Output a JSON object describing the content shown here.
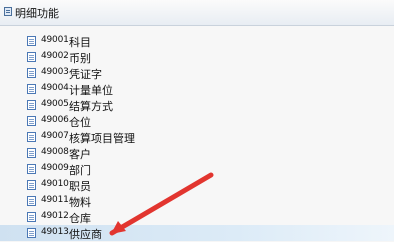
{
  "header": {
    "title": "明细功能",
    "icon": "panel-icon"
  },
  "items": [
    {
      "code": "49001",
      "label": "科目",
      "icon": "document-icon"
    },
    {
      "code": "49002",
      "label": "币别",
      "icon": "document-icon"
    },
    {
      "code": "49003",
      "label": "凭证字",
      "icon": "document-icon"
    },
    {
      "code": "49004",
      "label": "计量单位",
      "icon": "document-icon"
    },
    {
      "code": "49005",
      "label": "结算方式",
      "icon": "document-icon"
    },
    {
      "code": "49006",
      "label": "仓位",
      "icon": "document-icon"
    },
    {
      "code": "49007",
      "label": "核算项目管理",
      "icon": "document-icon"
    },
    {
      "code": "49008",
      "label": "客户",
      "icon": "document-icon"
    },
    {
      "code": "49009",
      "label": "部门",
      "icon": "document-icon"
    },
    {
      "code": "49010",
      "label": "职员",
      "icon": "document-icon"
    },
    {
      "code": "49011",
      "label": "物料",
      "icon": "document-icon"
    },
    {
      "code": "49012",
      "label": "仓库",
      "icon": "document-icon"
    },
    {
      "code": "49013",
      "label": "供应商",
      "icon": "document-icon",
      "selected": true
    }
  ],
  "annotation": {
    "type": "arrow",
    "color": "#e2352f"
  }
}
